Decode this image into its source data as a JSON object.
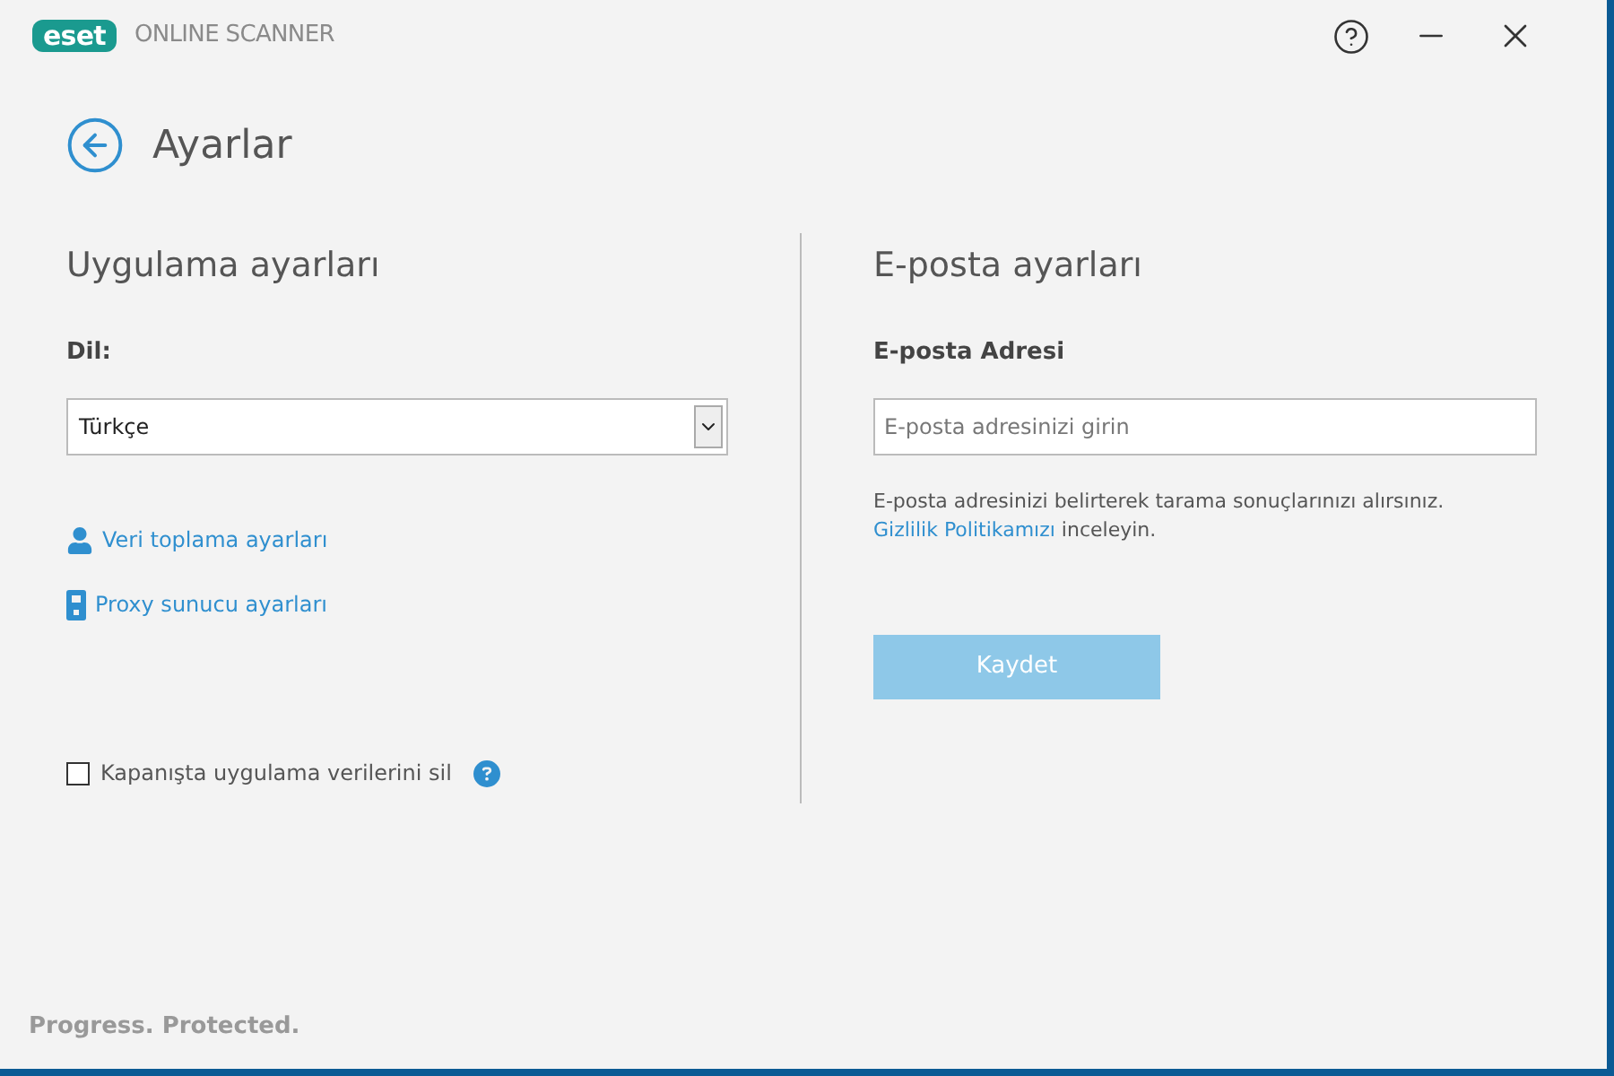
{
  "window": {
    "logo": "eset",
    "title": "ONLINE SCANNER"
  },
  "page": {
    "title": "Ayarlar"
  },
  "app_settings": {
    "heading": "Uygulama ayarları",
    "language_label": "Dil:",
    "language": "Türkçe",
    "links": [
      {
        "kind": "person",
        "label": "Veri toplama ayarları"
      },
      {
        "kind": "device",
        "label": "Proxy sunucu ayarları"
      }
    ],
    "checkbox": {
      "label": "Kapanışta uygulama verilerini sil",
      "checked": false
    }
  },
  "email_settings": {
    "heading": "E-posta ayarları",
    "field_label": "E-posta Adresi",
    "placeholder": "E-posta adresinizi girin",
    "note": "E-posta adresinizi belirterek tarama sonuçlarınızı alırsınız.",
    "note_link": "Gizlilik Politikamızı",
    "note_end": "inceleyin.",
    "save_button": {
      "label": "Kaydet",
      "disabled": true
    }
  },
  "footer": {
    "tagline": "Progress. Protected."
  }
}
